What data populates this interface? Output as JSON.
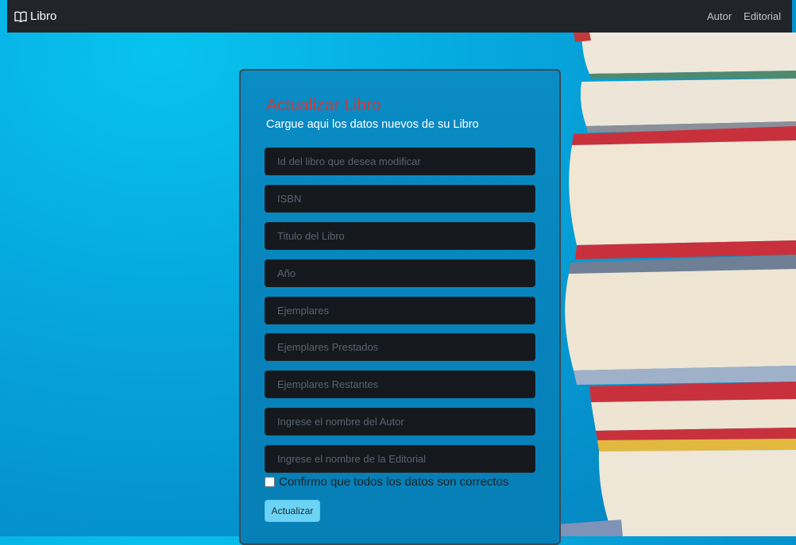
{
  "navbar": {
    "brand_icon": "book-icon",
    "brand_label": "Libro",
    "links": [
      {
        "label": "Autor"
      },
      {
        "label": "Editorial"
      }
    ]
  },
  "form": {
    "title": "Actualizar Libro",
    "subtitle": "Cargue aqui los datos nuevos de su Libro",
    "fields": [
      {
        "placeholder": "Id del libro que desea modificar",
        "value": ""
      },
      {
        "placeholder": "ISBN",
        "value": ""
      },
      {
        "placeholder": "Titulo del Libro",
        "value": ""
      },
      {
        "placeholder": "Año",
        "value": ""
      },
      {
        "placeholder": "Ejemplares",
        "value": ""
      },
      {
        "placeholder": "Ejemplares Prestados",
        "value": ""
      },
      {
        "placeholder": "Ejemplares Restantes",
        "value": ""
      },
      {
        "placeholder": "Ingrese el nombre del Autor",
        "value": ""
      },
      {
        "placeholder": "Ingrese el nombre de la Editorial",
        "value": ""
      }
    ],
    "confirm_label": "Confirmo que todos los datos son correctos",
    "confirm_checked": false,
    "submit_label": "Actualizar"
  },
  "colors": {
    "navbar_bg": "#212529",
    "title": "#d03a3a",
    "field_bg": "#15191d",
    "button_bg": "#6cd3f5",
    "background": "#06a9df"
  }
}
